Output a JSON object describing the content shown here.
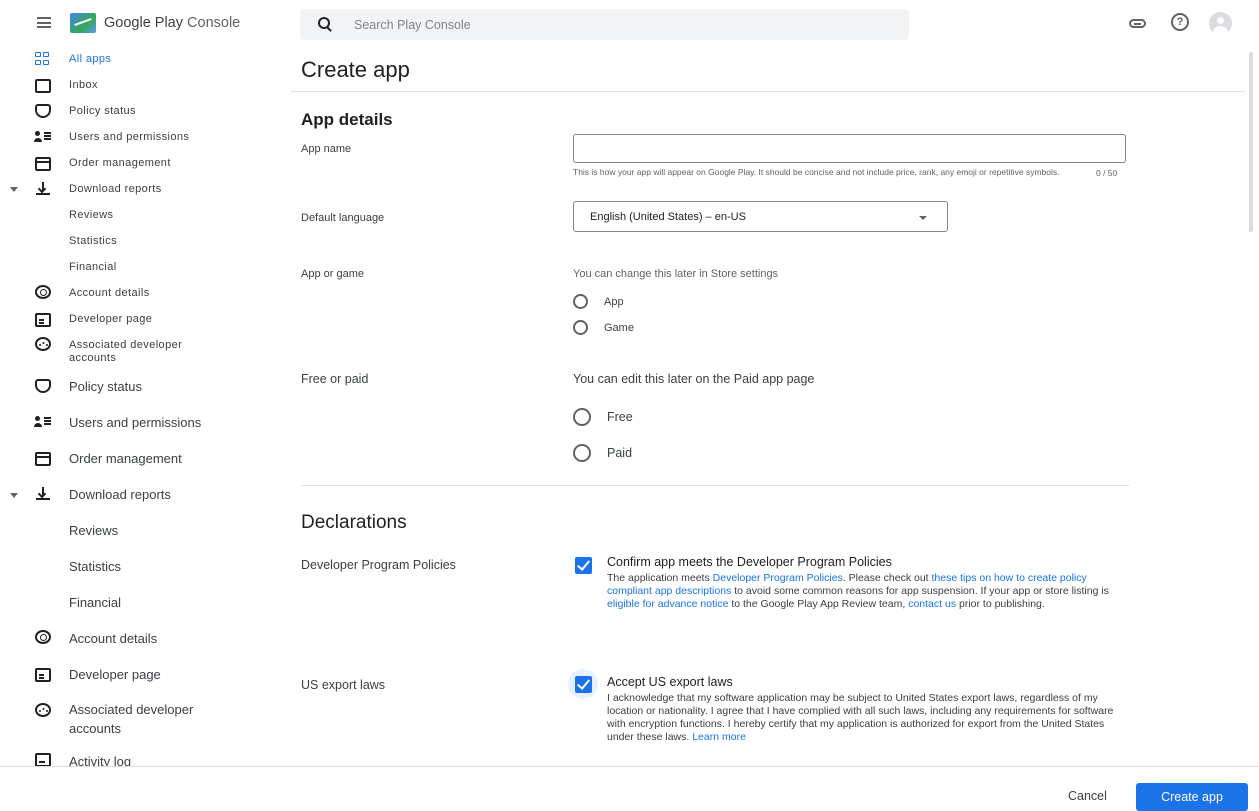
{
  "header": {
    "logo_text_main": "Google Play",
    "logo_text_sub": "Console",
    "search_placeholder": "Search Play Console",
    "icons": [
      "menu-icon",
      "search-icon",
      "link-icon",
      "help-icon",
      "avatar"
    ]
  },
  "sidebar": {
    "compact_items": [
      {
        "label": "All apps",
        "icon": "all-apps-icon",
        "active": true
      },
      {
        "label": "Inbox",
        "icon": "inbox-icon"
      },
      {
        "label": "Policy status",
        "icon": "shield-icon"
      },
      {
        "label": "Users and permissions",
        "icon": "people-icon"
      },
      {
        "label": "Order management",
        "icon": "card-icon"
      },
      {
        "label": "Download reports",
        "icon": "download-icon",
        "expanded": true
      },
      {
        "label": "Reviews"
      },
      {
        "label": "Statistics"
      },
      {
        "label": "Financial"
      },
      {
        "label": "Account details",
        "icon": "account-icon"
      },
      {
        "label": "Developer page",
        "icon": "developer-page-icon"
      },
      {
        "label": "Associated developer accounts",
        "icon": "associated-accounts-icon"
      }
    ],
    "items": [
      {
        "label": "Policy status",
        "icon": "shield-icon"
      },
      {
        "label": "Users and permissions",
        "icon": "people-icon"
      },
      {
        "label": "Order management",
        "icon": "card-icon"
      },
      {
        "label": "Download reports",
        "icon": "download-icon",
        "expanded": true
      },
      {
        "label": "Reviews"
      },
      {
        "label": "Statistics"
      },
      {
        "label": "Financial"
      },
      {
        "label": "Account details",
        "icon": "account-icon"
      },
      {
        "label": "Developer page",
        "icon": "developer-page-icon"
      },
      {
        "label": "Associated developer accounts",
        "icon": "associated-accounts-icon"
      },
      {
        "label": "Activity log",
        "icon": "activity-log-icon"
      }
    ]
  },
  "page": {
    "title": "Create app",
    "app_details": {
      "heading": "App details",
      "app_name_label": "App name",
      "app_name_value": "",
      "app_name_helper": "This is how your app will appear on Google Play. It should be concise and not include price, rank, any emoji or repetitive symbols.",
      "app_name_counter": "0 / 50",
      "default_language_label": "Default language",
      "default_language_value": "English (United States) – en-US",
      "app_or_game_label": "App or game",
      "app_or_game_hint": "You can change this later in Store settings",
      "app_or_game_options": [
        "App",
        "Game"
      ],
      "free_or_paid_label": "Free or paid",
      "free_or_paid_hint": "You can edit this later on the Paid app page",
      "free_or_paid_options": [
        "Free",
        "Paid"
      ]
    },
    "declarations": {
      "heading": "Declarations",
      "policies_label": "Developer Program Policies",
      "policies_checked": true,
      "policies_title": "Confirm app meets the Developer Program Policies",
      "policies_text": {
        "t1": "The application meets ",
        "l1": "Developer Program Policies",
        "t2": ". Please check out ",
        "l2": "these tips on how to create policy compliant app descriptions",
        "t3": " to avoid some common reasons for app suspension. If your app or store listing is ",
        "l3": "eligible for advance notice",
        "t4": " to the Google Play App Review team, ",
        "l4": "contact us",
        "t5": " prior to publishing."
      },
      "export_label": "US export laws",
      "export_checked": true,
      "export_title": "Accept US export laws",
      "export_text": "I acknowledge that my software application may be subject to United States export laws, regardless of my location or nationality. I agree that I have complied with all such laws, including any requirements for software with encryption functions. I hereby certify that my application is authorized for export from the United States under these laws. ",
      "export_link": "Learn more"
    }
  },
  "footer": {
    "cancel_label": "Cancel",
    "create_label": "Create app"
  },
  "colors": {
    "accent": "#1a73e8",
    "text": "#202124",
    "muted": "#5f6368",
    "divider": "#e0e0e0"
  }
}
